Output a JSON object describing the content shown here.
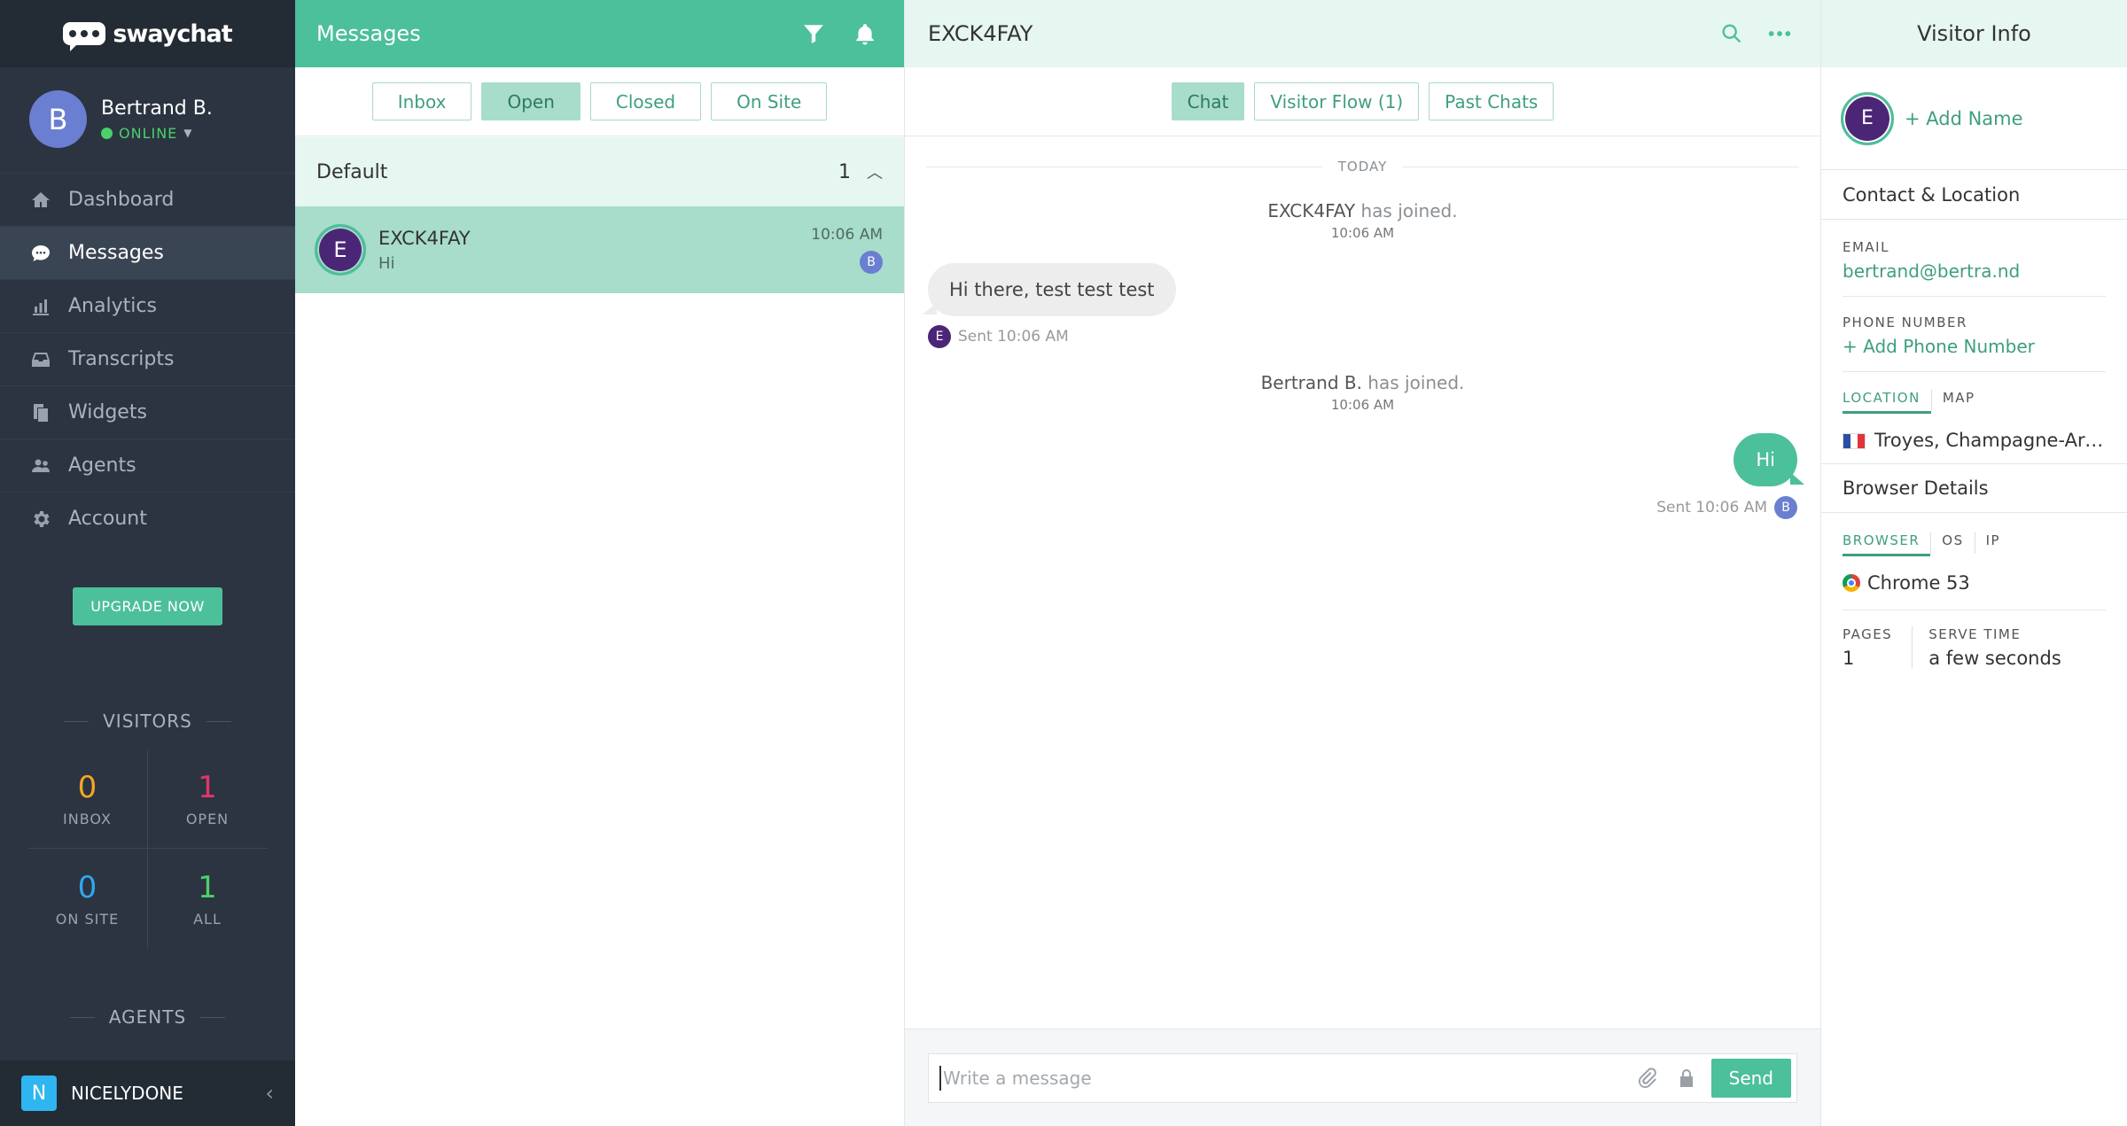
{
  "brand": {
    "name": "swaychat"
  },
  "user": {
    "initial": "B",
    "name": "Bertrand B.",
    "status": "ONLINE"
  },
  "nav": [
    {
      "label": "Dashboard",
      "icon": "home-icon"
    },
    {
      "label": "Messages",
      "icon": "chat-bubble-icon",
      "active": true
    },
    {
      "label": "Analytics",
      "icon": "bar-chart-icon"
    },
    {
      "label": "Transcripts",
      "icon": "inbox-tray-icon"
    },
    {
      "label": "Widgets",
      "icon": "copy-icon"
    },
    {
      "label": "Agents",
      "icon": "users-icon"
    },
    {
      "label": "Account",
      "icon": "gear-icon"
    }
  ],
  "upgrade_label": "UPGRADE NOW",
  "visitors": {
    "title": "VISITORS",
    "stats": [
      {
        "value": "0",
        "label": "INBOX",
        "color": "#f5a623"
      },
      {
        "value": "1",
        "label": "OPEN",
        "color": "#e2356b"
      },
      {
        "value": "0",
        "label": "ON SITE",
        "color": "#2fa8f0"
      },
      {
        "value": "1",
        "label": "ALL",
        "color": "#4bd06a"
      }
    ]
  },
  "agents_title": "AGENTS",
  "footer": {
    "initial": "N",
    "name": "NICELYDONE"
  },
  "messages": {
    "title": "Messages",
    "filters": [
      "Inbox",
      "Open",
      "Closed",
      "On Site"
    ],
    "active_filter": "Open",
    "group": {
      "name": "Default",
      "count": "1"
    },
    "conversation": {
      "initial": "E",
      "name": "EXCK4FAY",
      "preview": "Hi",
      "time": "10:06 AM",
      "agent_initial": "B"
    }
  },
  "chat": {
    "title": "EXCK4FAY",
    "tabs": [
      "Chat",
      "Visitor Flow (1)",
      "Past Chats"
    ],
    "day": "TODAY",
    "events": [
      {
        "name": "EXCK4FAY",
        "text": " has joined.",
        "time": "10:06 AM"
      },
      {
        "name": "Bertrand B.",
        "text": " has joined.",
        "time": "10:06 AM"
      }
    ],
    "incoming": {
      "text": "Hi there, test test test",
      "initial": "E",
      "sent": "Sent 10:06 AM"
    },
    "outgoing": {
      "text": "Hi",
      "initial": "B",
      "sent": "Sent 10:06 AM"
    },
    "composer_placeholder": "Write a message",
    "send_label": "Send"
  },
  "visitor_info": {
    "title": "Visitor Info",
    "initial": "E",
    "add_name": "+ Add Name",
    "contact_title": "Contact & Location",
    "email_label": "EMAIL",
    "email": "bertrand@bertra.nd",
    "phone_label": "PHONE NUMBER",
    "add_phone": "+ Add Phone Number",
    "location_tab": "LOCATION",
    "map_tab": "MAP",
    "location": "Troyes, Champagne-Ardenne",
    "browser_title": "Browser Details",
    "browser_tabs": [
      "BROWSER",
      "OS",
      "IP"
    ],
    "browser": "Chrome 53",
    "pages_label": "PAGES",
    "pages": "1",
    "serve_label": "SERVE TIME",
    "serve": "a few seconds"
  }
}
